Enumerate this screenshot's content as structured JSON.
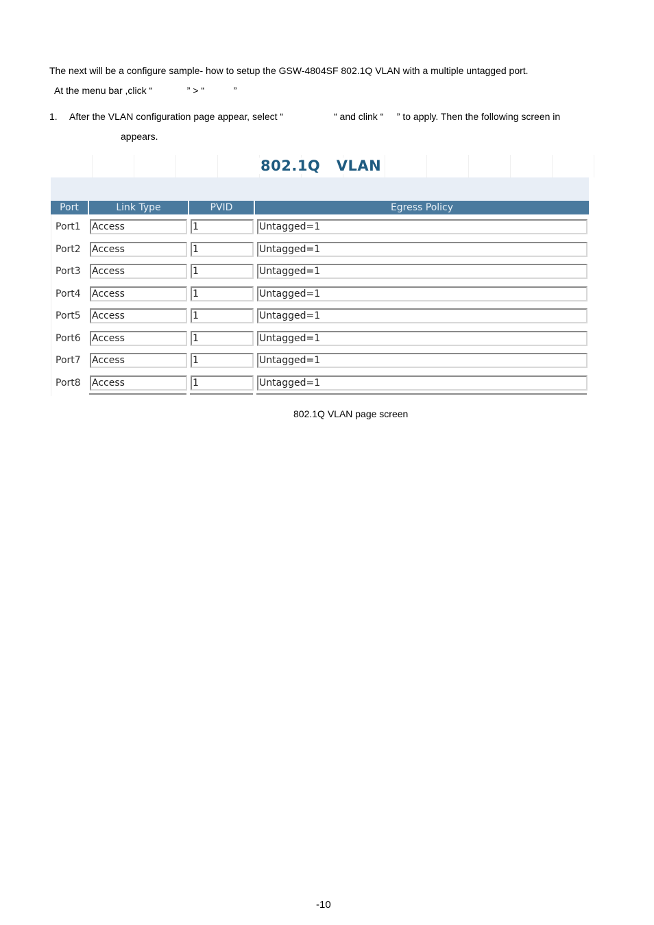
{
  "document": {
    "intro": "The next will be a configure sample- how to setup the GSW-4804SF 802.1Q VLAN with a multiple untagged port.",
    "menu_instruction": "At the menu bar ,click “             ” > “           ”",
    "step_number": "1.",
    "step_text": "After the VLAN configuration page appear, select “                   “ and clink “     ” to apply. Then the following screen in",
    "step_text_cont": "appears.",
    "caption": "802.1Q VLAN page screen",
    "page_number": "-10"
  },
  "screen": {
    "title": "802.1Q   VLAN",
    "colors": {
      "header_bg": "#4a7a9e",
      "title": "#1f5b80",
      "band": "#e8eef6"
    },
    "columns": [
      "Port",
      "Link Type",
      "PVID",
      "Egress Policy"
    ],
    "rows": [
      {
        "port": "Port1",
        "link_type": "Access",
        "pvid": "1",
        "egress": "Untagged=1"
      },
      {
        "port": "Port2",
        "link_type": "Access",
        "pvid": "1",
        "egress": "Untagged=1"
      },
      {
        "port": "Port3",
        "link_type": "Access",
        "pvid": "1",
        "egress": "Untagged=1"
      },
      {
        "port": "Port4",
        "link_type": "Access",
        "pvid": "1",
        "egress": "Untagged=1"
      },
      {
        "port": "Port5",
        "link_type": "Access",
        "pvid": "1",
        "egress": "Untagged=1"
      },
      {
        "port": "Port6",
        "link_type": "Access",
        "pvid": "1",
        "egress": "Untagged=1"
      },
      {
        "port": "Port7",
        "link_type": "Access",
        "pvid": "1",
        "egress": "Untagged=1"
      },
      {
        "port": "Port8",
        "link_type": "Access",
        "pvid": "1",
        "egress": "Untagged=1"
      }
    ]
  }
}
